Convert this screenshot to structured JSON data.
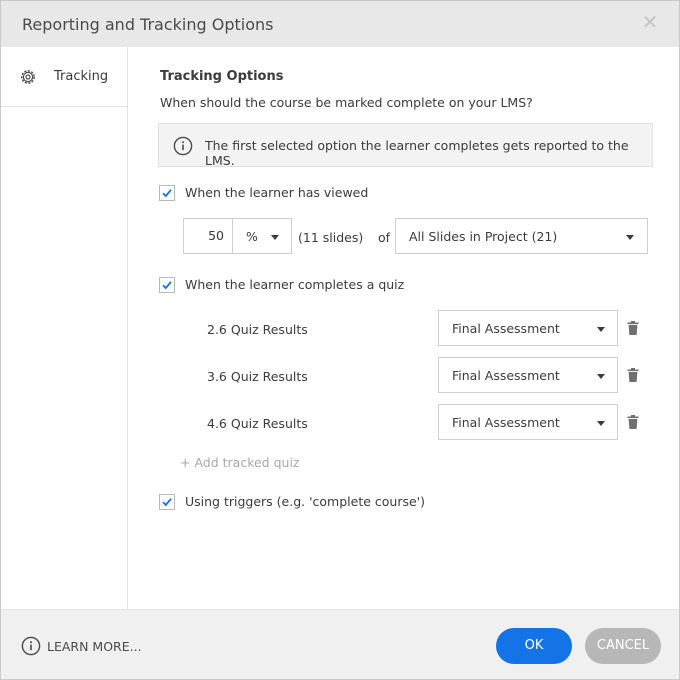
{
  "dialog": {
    "title": "Reporting and Tracking Options",
    "close_icon": "close-icon"
  },
  "sidebar": {
    "items": [
      {
        "label": "Tracking",
        "icon": "gear-icon"
      }
    ]
  },
  "main": {
    "heading": "Tracking Options",
    "question": "When should the course be marked complete on your LMS?",
    "info": {
      "icon": "info-icon",
      "text": "The first selected option the learner completes gets reported to the LMS."
    },
    "viewed": {
      "checked": true,
      "label": "When the learner has viewed",
      "amount_value": "50",
      "unit_value": "%",
      "slides_note": "(11 slides)",
      "of_label": "of",
      "scope_value": "All Slides in Project (21)"
    },
    "quiz": {
      "checked": true,
      "label": "When the learner completes a quiz",
      "rows": [
        {
          "label": "2.6 Quiz Results",
          "value": "Final Assessment"
        },
        {
          "label": "3.6 Quiz Results",
          "value": "Final Assessment"
        },
        {
          "label": "4.6 Quiz Results",
          "value": "Final Assessment"
        }
      ],
      "add_label": "+ Add tracked quiz"
    },
    "triggers": {
      "checked": true,
      "label": "Using triggers (e.g. 'complete course')"
    }
  },
  "footer": {
    "learn_more": "LEARN MORE...",
    "ok_label": "OK",
    "cancel_label": "CANCEL"
  },
  "colors": {
    "accent": "#1473e6",
    "checkmark": "#1473e6",
    "cancel": "#b7b7b7"
  }
}
